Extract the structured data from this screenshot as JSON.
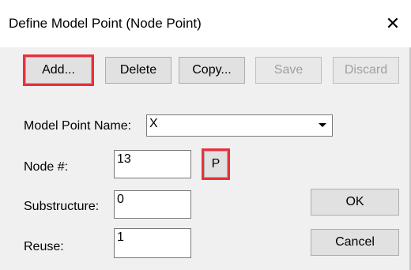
{
  "window": {
    "title": "Define Model Point (Node Point)",
    "close_glyph": "✕"
  },
  "toolbar": {
    "add_label": "Add...",
    "delete_label": "Delete",
    "copy_label": "Copy...",
    "save_label": "Save",
    "discard_label": "Discard"
  },
  "form": {
    "model_point_name_label": "Model Point Name:",
    "model_point_name_value": "X",
    "node_label": "Node #:",
    "node_value": "13",
    "pick_label": "P",
    "substructure_label": "Substructure:",
    "substructure_value": "0",
    "reuse_label": "Reuse:",
    "reuse_value": "1"
  },
  "actions": {
    "ok_label": "OK",
    "cancel_label": "Cancel"
  },
  "colors": {
    "highlight": "#e8303a",
    "disabled_text": "#a0a0a0"
  }
}
